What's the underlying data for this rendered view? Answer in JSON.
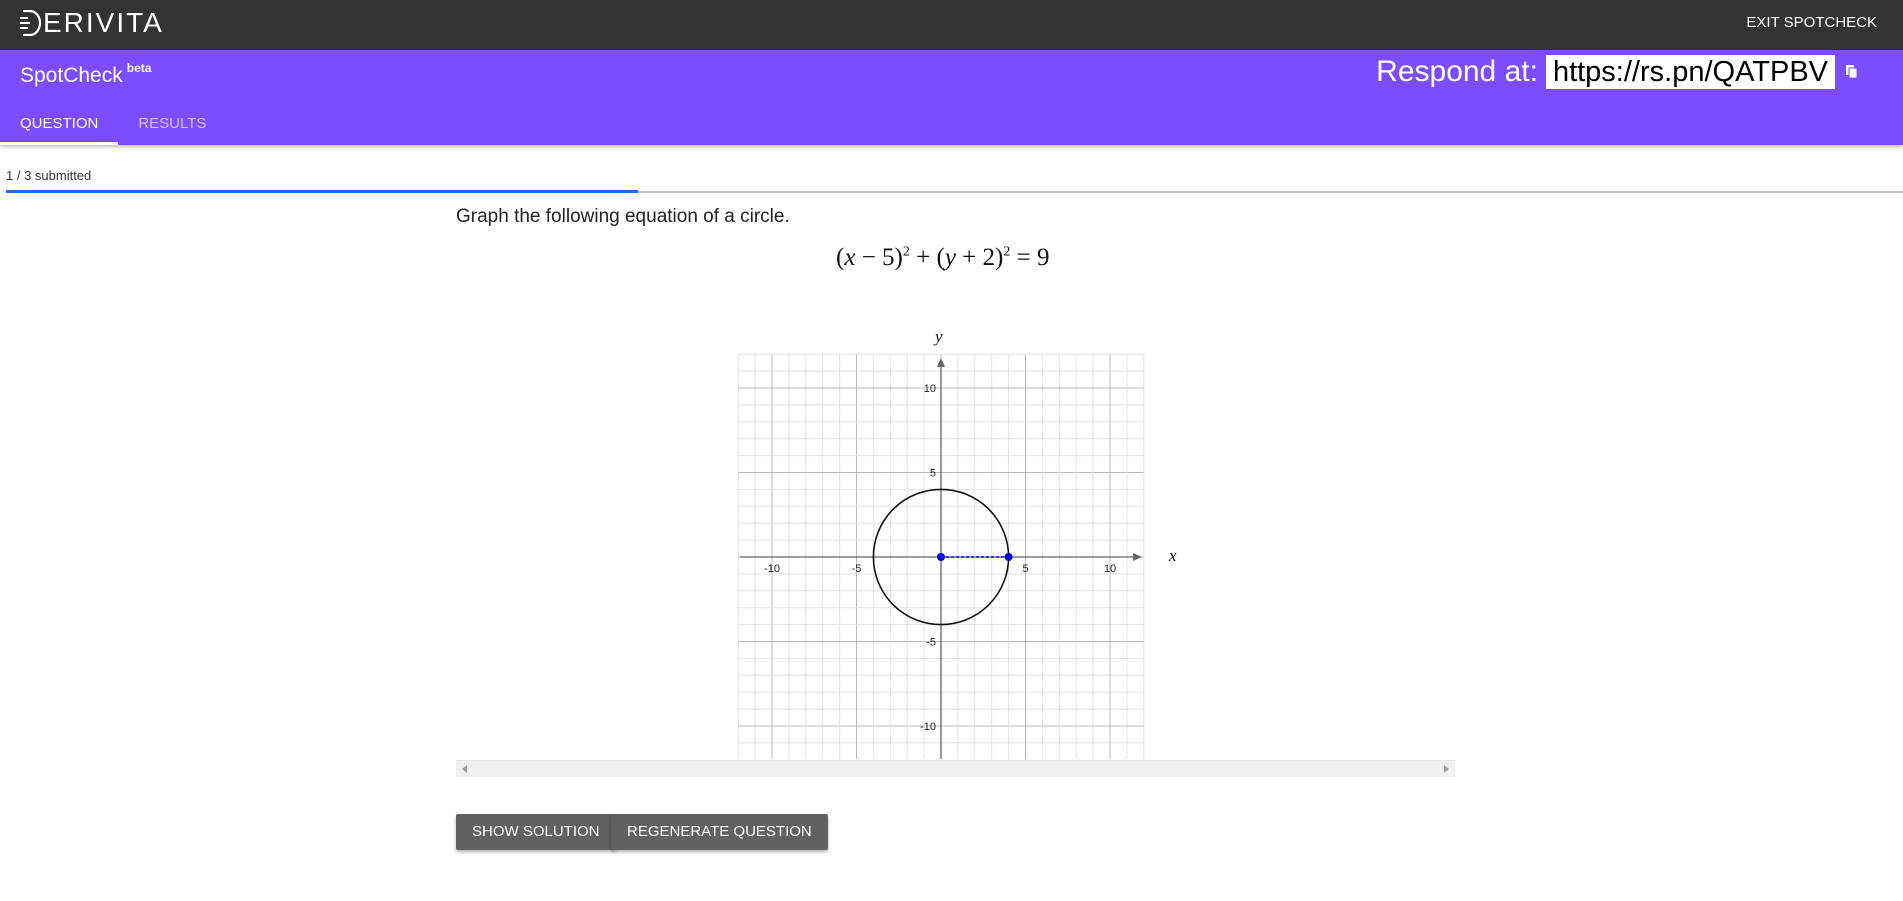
{
  "app": {
    "logo_text": "ERIVITA",
    "exit_label": "EXIT SPOTCHECK"
  },
  "header": {
    "title": "SpotCheck",
    "title_badge": "beta",
    "respond_label": "Respond at:",
    "respond_url": "https://rs.pn/QATPBV",
    "tabs": [
      {
        "label": "QUESTION",
        "active": true
      },
      {
        "label": "RESULTS",
        "active": false
      }
    ]
  },
  "progress": {
    "text": "1 / 3 submitted",
    "fraction": 0.3333
  },
  "question": {
    "prompt": "Graph the following equation of a circle."
  },
  "graph": {
    "x_label": "x",
    "y_label": "y",
    "x_ticks": [
      "-10",
      "-5",
      "5",
      "10"
    ],
    "y_ticks": [
      "10",
      "5",
      "-5",
      "-10"
    ],
    "circle_center": [
      0,
      0
    ],
    "circle_radius": 4,
    "radius_point": [
      4,
      0
    ],
    "point_color": "#0000ee"
  },
  "buttons": {
    "show_solution": "SHOW SOLUTION",
    "regenerate": "REGENERATE QUESTION"
  },
  "colors": {
    "topbar": "#333333",
    "header": "#7c4dff",
    "progress": "#1e6fd9",
    "button": "#616161"
  }
}
